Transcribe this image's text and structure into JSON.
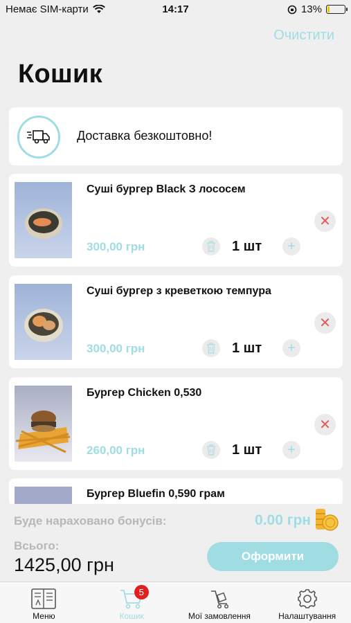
{
  "status_bar": {
    "carrier": "Немає SIM-карти",
    "time": "14:17",
    "battery": "13%",
    "battery_level": 0.13
  },
  "header": {
    "clear_label": "Очистити",
    "title": "Кошик"
  },
  "delivery": {
    "text": "Доставка безкоштовно!",
    "icon": "delivery-truck-icon"
  },
  "items": [
    {
      "name": "Суші бургер Black З лососем",
      "price": "300,00 грн",
      "qty": "1 шт"
    },
    {
      "name": "Суші бургер з креветкою темпура",
      "price": "300,00 грн",
      "qty": "1 шт"
    },
    {
      "name": "Бургер Chicken 0,530",
      "price": "260,00 грн",
      "qty": "1 шт"
    },
    {
      "name": "Бургер Bluefin 0,590 грам"
    }
  ],
  "summary": {
    "bonus_label": "Буде нараховано бонусів:",
    "bonus_value": "0.00 грн",
    "total_label": "Всього:",
    "total_value": "1425,00 грн",
    "checkout_label": "Оформити"
  },
  "tabs": [
    {
      "label": "Меню",
      "icon": "menu-book-icon"
    },
    {
      "label": "Кошик",
      "icon": "cart-icon",
      "badge": "5",
      "active": true
    },
    {
      "label": "Мої замовлення",
      "icon": "orders-cart-icon"
    },
    {
      "label": "Налаштування",
      "icon": "gear-icon"
    }
  ],
  "colors": {
    "accent": "#9fdde3",
    "remove": "#e05a5a",
    "badge": "#e0201f",
    "background": "#efefef"
  }
}
